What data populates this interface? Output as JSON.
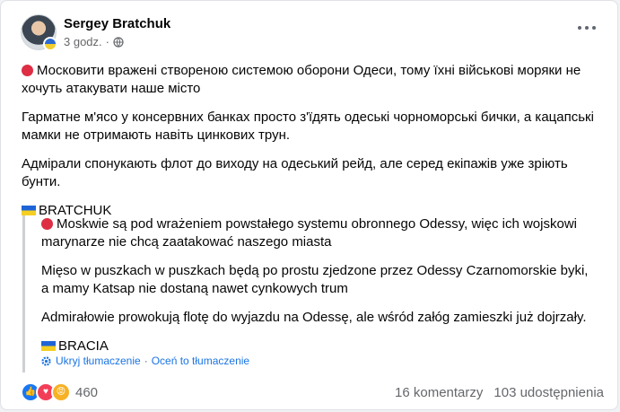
{
  "post": {
    "author": "Sergey Bratchuk",
    "time": "3 godz.",
    "time_separator": "·",
    "paragraphs": [
      "Московити вражені створеною системою оборони Одеси, тому їхні військові моряки не хочуть атакувати наше місто",
      "Гарматне м'ясо у консервних банках просто з'їдять одеські чорноморські бички, а кацапські мамки не отримають навіть цинкових трун.",
      "Адмірали спонукають флот до виходу на одеський рейд, але серед екіпажів уже зріють бунти."
    ],
    "signature": "BRATCHUK"
  },
  "translation": {
    "paragraphs": [
      "Moskwie są pod wrażeniem powstałego systemu obronnego Odessy, więc ich wojskowi marynarze nie chcą zaatakować naszego miasta",
      "Mięso w puszkach w puszkach będą po prostu zjedzone przez Odessy Czarnomorskie byki, a mamy Katsap nie dostaną nawet cynkowych trum",
      "Admirałowie prowokują flotę do wyjazdu na Odessę, ale wśród załóg zamieszki już dojrzały."
    ],
    "signature": "BRACIA",
    "hide_label": "Ukryj tłumaczenie",
    "separator": "·",
    "rate_label": "Oceń to tłumaczenie"
  },
  "footer": {
    "reaction_count": "460",
    "comments": "16 komentarzy",
    "shares": "103 udostępnienia",
    "reactions": [
      "like",
      "love",
      "angry"
    ]
  },
  "colors": {
    "link": "#1b74e4",
    "muted": "#65676b",
    "red_circle": "#dd2e44",
    "like": "#1877f2",
    "love": "#f33e58"
  }
}
